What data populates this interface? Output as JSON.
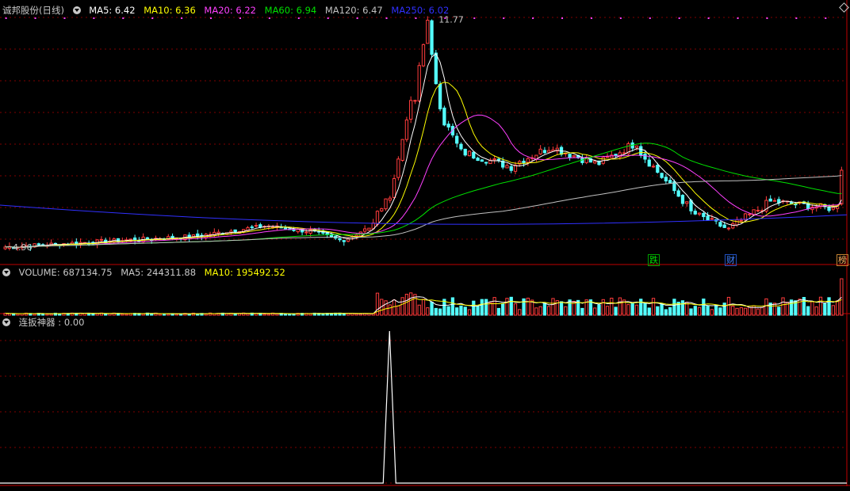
{
  "header": {
    "stock_name": "诚邦股份(日线)",
    "ma5_label": "MA5: 6.42",
    "ma10_label": "MA10: 6.36",
    "ma20_label": "MA20: 6.22",
    "ma60_label": "MA60: 6.94",
    "ma120_label": "MA120: 6.47",
    "ma250_label": "MA250: 6.02"
  },
  "volume_header": {
    "volume_label": "VOLUME: 687134.75",
    "ma5_label": "MA5: 244311.88",
    "ma10_label": "MA10: 195492.52"
  },
  "indicator_header": {
    "label": "连扳神器 : 0.00"
  },
  "price_panel": {
    "high_label": "11.77",
    "low_label": "4.96",
    "badges": [
      "跌",
      "财",
      "榜"
    ]
  },
  "colors": {
    "up": "#ff3c3c",
    "down": "#54ffff",
    "ma5": "#ffffff",
    "ma10": "#ffff00",
    "ma20": "#ff40ff",
    "ma60": "#00e000",
    "ma120": "#c0c0c0",
    "ma250": "#3030ff",
    "grid": "#800000"
  },
  "chart_data": {
    "type": "candlestick",
    "price_range": [
      4.96,
      11.77
    ],
    "segments": [
      {
        "bars": 45,
        "start": 5.1,
        "end": 5.4,
        "noise": 0.06
      },
      {
        "bars": 18,
        "start": 5.4,
        "end": 5.7,
        "noise": 0.06
      },
      {
        "bars": 10,
        "start": 5.7,
        "end": 5.55,
        "noise": 0.05
      },
      {
        "bars": 8,
        "start": 5.55,
        "end": 5.3,
        "noise": 0.06
      },
      {
        "bars": 6,
        "start": 5.3,
        "end": 5.6,
        "noise": 0.05
      },
      {
        "bars": 5,
        "start": 5.6,
        "end": 6.5,
        "noise": 0.08
      },
      {
        "bars": 6,
        "start": 6.5,
        "end": 9.3,
        "noise": 0.0
      },
      {
        "bars": 2,
        "start": 9.3,
        "end": 10.3,
        "noise": 0.0
      },
      {
        "bars": 2,
        "start": 10.9,
        "end": 11.6,
        "noise": 0.0
      },
      {
        "bars": 3,
        "start": 10.5,
        "end": 9.2,
        "noise": 0.15
      },
      {
        "bars": 5,
        "start": 8.7,
        "end": 7.8,
        "noise": 0.15
      },
      {
        "bars": 12,
        "start": 7.8,
        "end": 7.4,
        "noise": 0.12
      },
      {
        "bars": 10,
        "start": 7.5,
        "end": 8.0,
        "noise": 0.12
      },
      {
        "bars": 10,
        "start": 7.9,
        "end": 7.5,
        "noise": 0.12
      },
      {
        "bars": 10,
        "start": 7.5,
        "end": 8.1,
        "noise": 0.12
      },
      {
        "bars": 12,
        "start": 7.8,
        "end": 6.3,
        "noise": 0.12
      },
      {
        "bars": 10,
        "start": 6.1,
        "end": 5.6,
        "noise": 0.1
      },
      {
        "bars": 10,
        "start": 5.7,
        "end": 6.4,
        "noise": 0.12
      },
      {
        "bars": 15,
        "start": 6.4,
        "end": 6.2,
        "noise": 0.1
      },
      {
        "bars": 2,
        "start": 6.3,
        "end": 7.3,
        "noise": 0.0
      }
    ],
    "volume_max": 687134.75,
    "volume_profile": "low-before-rally-high-after",
    "indicator_spike_bar_ratio": 0.46,
    "indicator_value": 0.0
  }
}
